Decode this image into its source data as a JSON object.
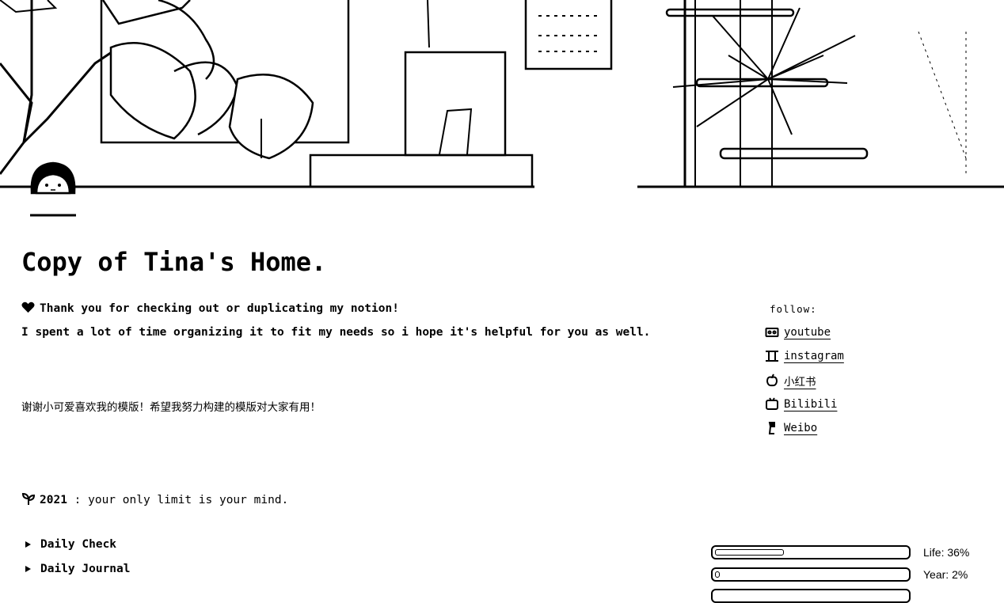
{
  "page": {
    "title": "Copy of Tina's Home."
  },
  "intro": {
    "line1": "Thank you for checking out or duplicating my notion!",
    "line2": "I spent a lot of time organizing it to fit my needs so i hope it's helpful for you as well.",
    "line_cn": "谢谢小可爱喜欢我的模版！希望我努力构建的模版对大家有用！"
  },
  "motto": {
    "year": "2021",
    "text": " : your only limit is your mind."
  },
  "follow": {
    "heading": "follow:",
    "links": [
      {
        "label": "youtube",
        "icon": "video-tape-icon"
      },
      {
        "label": "instagram",
        "icon": "film-strip-icon"
      },
      {
        "label": "小红书",
        "icon": "apple-icon"
      },
      {
        "label": "Bilibili",
        "icon": "tv-icon"
      },
      {
        "label": "Weibo",
        "icon": "tape-dispenser-icon"
      }
    ]
  },
  "toggles": [
    {
      "label": "Daily Check"
    },
    {
      "label": "Daily Journal"
    }
  ],
  "progress": [
    {
      "label": "Life: 36%",
      "value": 0.36
    },
    {
      "label": "Year: 2%",
      "value": 0.02
    }
  ]
}
